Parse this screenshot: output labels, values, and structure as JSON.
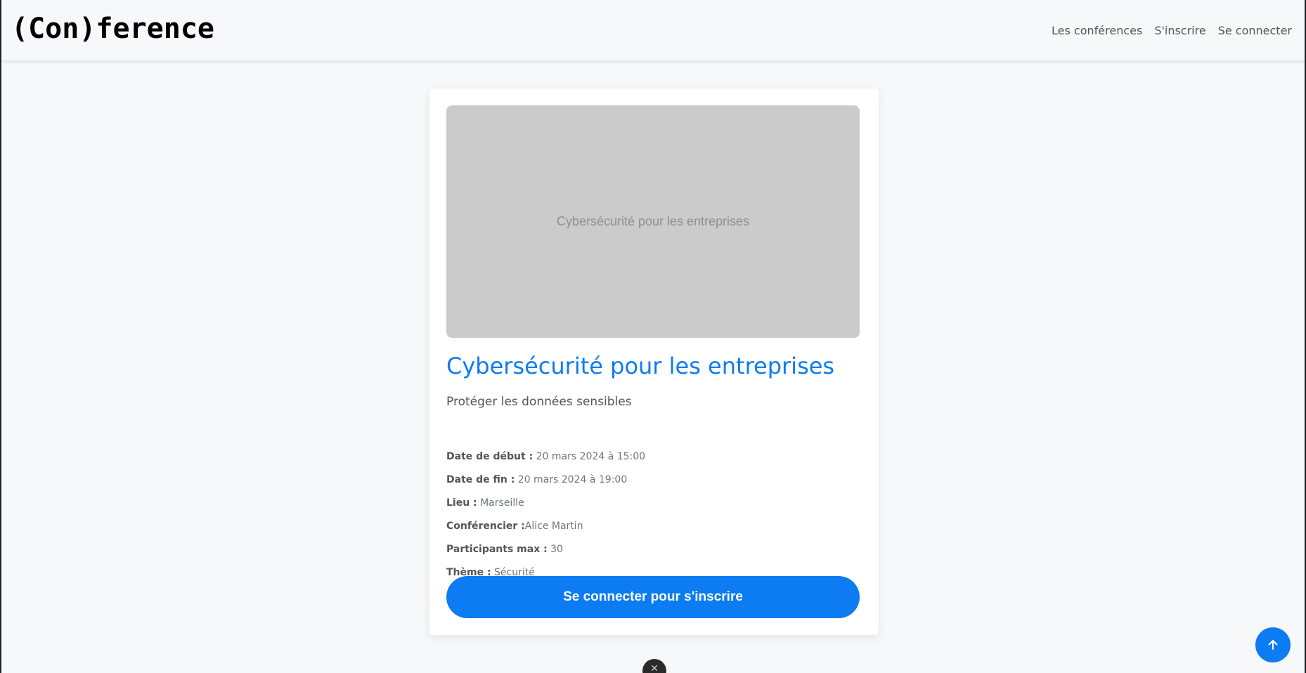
{
  "navbar": {
    "brand": "(Con)ference",
    "links": [
      "Les conférences",
      "S'inscrire",
      "Se connecter"
    ]
  },
  "conference": {
    "image_alt": "Cybersécurité pour les entreprises",
    "title": "Cybersécurité pour les entreprises",
    "subtitle": "Protéger les données sensibles",
    "details": [
      {
        "label": "Date de début :",
        "value": " 20 mars 2024 à 15:00"
      },
      {
        "label": "Date de fin :",
        "value": " 20 mars 2024 à 19:00"
      },
      {
        "label": "Lieu :",
        "value": " Marseille"
      },
      {
        "label": "Conférencier :",
        "value": "Alice Martin"
      },
      {
        "label": "Participants max :",
        "value": " 30"
      },
      {
        "label": "Thème :",
        "value": " Sécurité"
      }
    ],
    "cta_label": "Se connecter pour s'inscrire"
  },
  "floating": {
    "scroll_top_icon": "arrow-up-icon",
    "close_icon": "close-icon",
    "close_glyph": "✕"
  },
  "colors": {
    "accent": "#0d7bf2",
    "placeholder_bg": "#cbcbcb"
  }
}
